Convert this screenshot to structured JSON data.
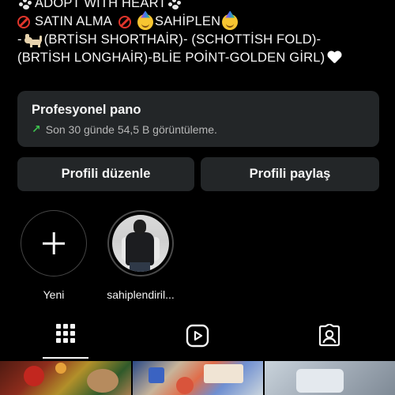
{
  "profile": {
    "bio_line1": "ADOPT WITH HEART",
    "bio_line2a": "SATIN ALMA",
    "bio_line2b": "SAHİPLEN",
    "bio_line3a": "-",
    "bio_line3b": "(BRTİSH SHORTHAİR)- (SCHOTTİSH FOLD)-",
    "bio_line4": "(BRTİSH LONGHAİR)-BLİE POİNT-GOLDEN GİRL)"
  },
  "dashboard": {
    "title": "Profesyonel pano",
    "subtitle": "Son 30 günde 54,5 B görüntüleme."
  },
  "buttons": {
    "edit_profile": "Profili düzenle",
    "share_profile": "Profili paylaş"
  },
  "highlights": [
    {
      "label": "Yeni",
      "icon": "plus-icon"
    },
    {
      "label": "sahiplendiril..."
    }
  ],
  "tabs": [
    {
      "id": "posts",
      "icon": "grid-icon",
      "active": true
    },
    {
      "id": "reels",
      "icon": "reels-icon",
      "active": false
    },
    {
      "id": "tagged",
      "icon": "tagged-icon",
      "active": false
    }
  ],
  "colors": {
    "background": "#000000",
    "card": "#232628",
    "trend": "#3ec34f",
    "no_sign": "#e0352b"
  }
}
